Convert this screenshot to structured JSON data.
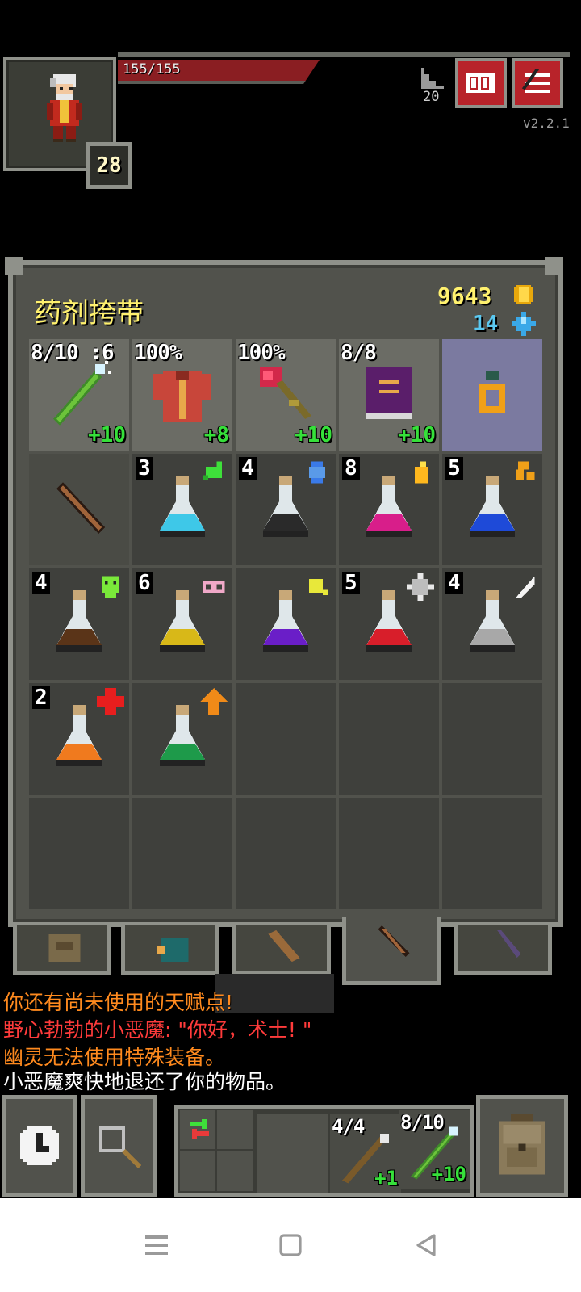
{
  "hud": {
    "hp_text": "155/155",
    "level": "28",
    "depth": "20",
    "version": "v2.2.1",
    "journal_icon": "journal-icon",
    "menu_icon": "menu-icon"
  },
  "bag": {
    "title": "药剂挎带",
    "gold": "9643",
    "gems": "14",
    "equipped": [
      {
        "name": "magic-wand",
        "status": "8/10 :6",
        "bonus": "+10"
      },
      {
        "name": "cloth-armor",
        "status": "100%",
        "bonus": "+8"
      },
      {
        "name": "rose-staff",
        "status": "100%",
        "bonus": "+10"
      },
      {
        "name": "spell-book",
        "status": "8/8",
        "bonus": "+10"
      },
      {
        "name": "ring",
        "status": "",
        "bonus": ""
      }
    ],
    "items": [
      {
        "name": "dart",
        "qty": ""
      },
      {
        "name": "potion-cyan",
        "qty": "3"
      },
      {
        "name": "potion-black",
        "qty": "4"
      },
      {
        "name": "potion-magenta",
        "qty": "8"
      },
      {
        "name": "potion-blue",
        "qty": "5"
      },
      {
        "name": "potion-brown",
        "qty": "4"
      },
      {
        "name": "potion-yellow",
        "qty": "6"
      },
      {
        "name": "potion-purple",
        "qty": ""
      },
      {
        "name": "potion-red",
        "qty": "5"
      },
      {
        "name": "potion-silver",
        "qty": "4"
      },
      {
        "name": "potion-orange",
        "qty": "2"
      },
      {
        "name": "potion-green",
        "qty": ""
      }
    ]
  },
  "log": [
    {
      "text": "你还有尚未使用的天赋点!",
      "color": "#ff8a1e"
    },
    {
      "text": "野心勃勃的小恶魔: \"你好，术士! \"",
      "color": "#ff3b3b"
    },
    {
      "text": "幽灵无法使用特殊装备。",
      "color": "#ff8a1e"
    },
    {
      "text": "小恶魔爽快地退还了你的物品。",
      "color": "#ffffff"
    }
  ],
  "quickslots": [
    {
      "status": "4/4",
      "bonus": "+1"
    },
    {
      "status": "8/10",
      "bonus": "+10"
    }
  ],
  "colors": {
    "accent_red": "#b8232a",
    "gold": "#fff16e",
    "bonus_green": "#36e03a",
    "frame": "#8f918a",
    "panel": "#51524c"
  }
}
